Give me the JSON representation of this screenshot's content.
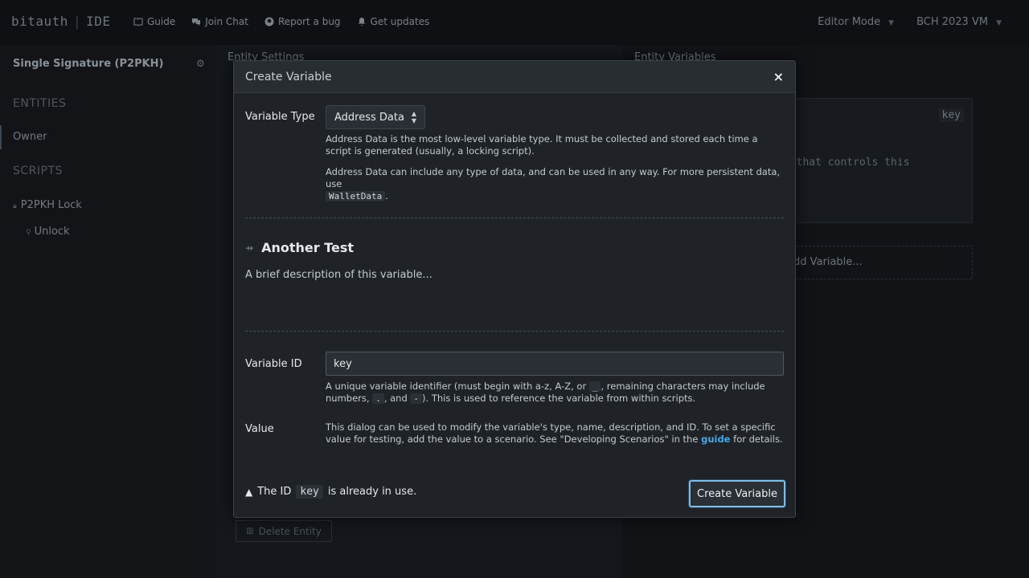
{
  "app": {
    "brand_left": "bitauth",
    "brand_right": "IDE"
  },
  "nav": {
    "guide": "Guide",
    "join_chat": "Join Chat",
    "report_bug": "Report a bug",
    "get_updates": "Get updates"
  },
  "top_right": {
    "mode": "Editor Mode",
    "vm": "BCH 2023 VM"
  },
  "sidebar": {
    "template_title": "Single Signature (P2PKH)",
    "entities_heading": "ENTITIES",
    "entities": [
      "Owner"
    ],
    "scripts_heading": "SCRIPTS",
    "scripts": [
      "P2PKH Lock",
      "Unlock"
    ]
  },
  "middle": {
    "title": "Entity Settings",
    "delete_button": "Delete Entity"
  },
  "right": {
    "title": "Entity Variables",
    "card_key": "key",
    "card_desc": "y that controls this",
    "add_variable": "dd Variable..."
  },
  "modal": {
    "title": "Create Variable",
    "variable_type_label": "Variable Type",
    "variable_type_value": "Address Data",
    "type_help_1": "Address Data is the most low-level variable type. It must be collected and stored each time a script is generated (usually, a locking script).",
    "type_help_2_prefix": "Address Data can include any type of data, and can be used in any way. For more persistent data, use",
    "type_help_2_code": "WalletData",
    "type_help_2_suffix": ".",
    "variable_name": "Another Test",
    "variable_description": "A brief description of this variable...",
    "variable_id_label": "Variable ID",
    "variable_id_value": "key",
    "id_help_1": "A unique variable identifier (must begin with a-z, A-Z, or",
    "id_help_code_1": "_",
    "id_help_2": ", remaining characters may include numbers,",
    "id_help_code_2": ".",
    "id_help_3": ", and",
    "id_help_code_3": "-",
    "id_help_4": "). This is used to reference the variable from within scripts.",
    "value_label": "Value",
    "value_help_prefix": "This dialog can be used to modify the variable's type, name, description, and ID. To set a specific value for testing, add the value to a scenario. See \"Developing Scenarios\" in the",
    "value_help_link": "guide",
    "value_help_suffix": "for details.",
    "warning_prefix": "The ID",
    "warning_code": "key",
    "warning_suffix": "is already in use.",
    "create_button": "Create Variable",
    "close_symbol": "×"
  }
}
